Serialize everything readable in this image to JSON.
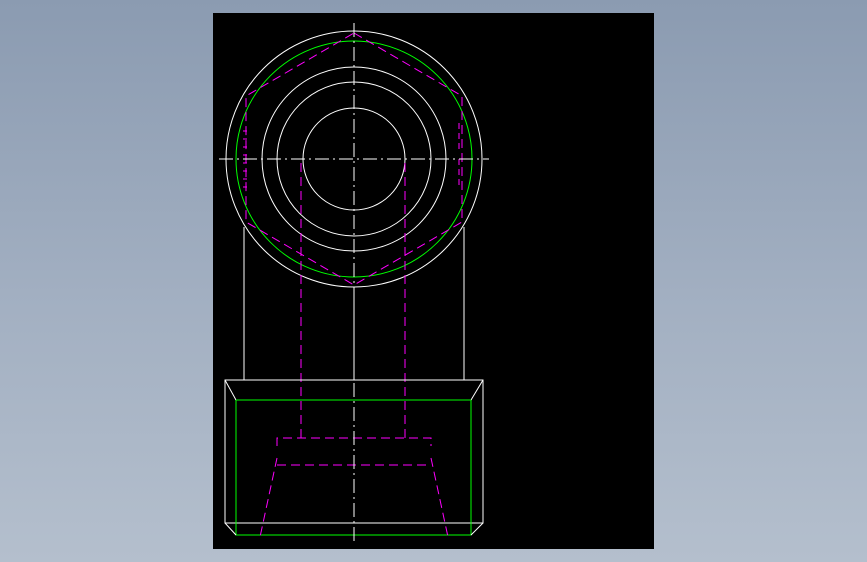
{
  "viewport": {
    "background": "#000000"
  },
  "colors": {
    "page_background": "#97a5ba",
    "outline": "#ffffff",
    "hidden": "#ff00ff",
    "thread": "#00ff00",
    "centerline": "#ffffff"
  }
}
